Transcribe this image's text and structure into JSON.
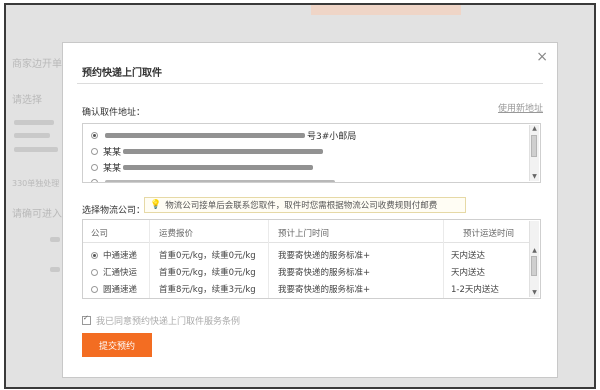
{
  "background": {
    "side_texts": [
      "商家边开单",
      "请选择",
      "330单独处理",
      "请确可进入"
    ]
  },
  "modal": {
    "title": "预约快递上门取件",
    "close_icon": "close-icon",
    "address_label": "确认取件地址：",
    "use_new_address": "使用新地址",
    "addresses": [
      {
        "name": "",
        "tail": "号3#小邮局",
        "selected": true
      },
      {
        "name": "某某",
        "tail": "",
        "selected": false
      },
      {
        "name": "某某",
        "tail": "",
        "selected": false
      }
    ],
    "choose_label": "选择物流公司：",
    "tip_icon": "lightbulb-icon",
    "tip_text": "物流公司接单后会联系您取件，取件时您需根据物流公司收费规则付邮费",
    "columns": [
      "公司",
      "运费报价",
      "预计上门时间",
      "预计运送时间"
    ],
    "rows": [
      {
        "company": "中通速递",
        "price": "首重0元/kg，续重0元/kg",
        "pickup": "我要寄快递的服务标准+",
        "delivery": "天内送达",
        "selected": true
      },
      {
        "company": "汇通快运",
        "price": "首重0元/kg，续重0元/kg",
        "pickup": "我要寄快递的服务标准+",
        "delivery": "天内送达",
        "selected": false
      },
      {
        "company": "圆通速递",
        "price": "首重8元/kg，续重3元/kg",
        "pickup": "我要寄快递的服务标准+",
        "delivery": "1-2天内送达",
        "selected": false
      }
    ],
    "agree_text": "我已同意预约快递上门取件服务条例",
    "agree_checked": true,
    "submit_label": "提交预约"
  },
  "colors": {
    "submit": "#f36d22",
    "tip_border": "#e6d9a6"
  }
}
